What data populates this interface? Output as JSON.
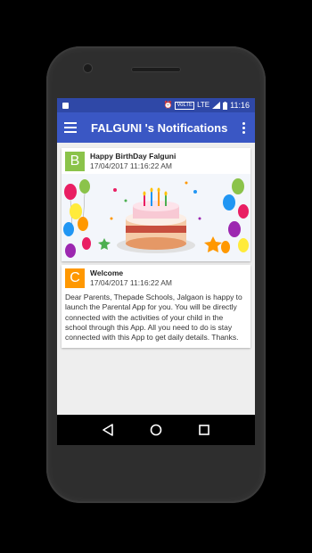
{
  "status_bar": {
    "volte": "VoLTE",
    "network": "LTE",
    "time": "11:16"
  },
  "app_bar": {
    "title": "FALGUNI 's Notifications"
  },
  "notifications": [
    {
      "avatar_letter": "B",
      "avatar_color": "#8bc34a",
      "title": "Happy BirthDay Falguni",
      "date": "17/04/2017 11:16:22 AM",
      "image": "birthday-cake-balloons"
    },
    {
      "avatar_letter": "C",
      "avatar_color": "#ff9800",
      "title": "Welcome",
      "date": "17/04/2017 11:16:22 AM",
      "body": "Dear Parents, Thepade Schools, Jalgaon is happy to launch the Parental App for you. You will be directly connected with the activities of your child in the school through this App. All you need to do is stay connected with this App to get daily details. Thanks."
    }
  ],
  "colors": {
    "status_bar": "#2f48a7",
    "app_bar": "#3a57c4",
    "background": "#eeeeee"
  },
  "icons": {
    "menu": "hamburger-icon",
    "overflow": "overflow-menu-icon",
    "back": "back-icon",
    "home": "home-icon",
    "recents": "recents-icon"
  }
}
